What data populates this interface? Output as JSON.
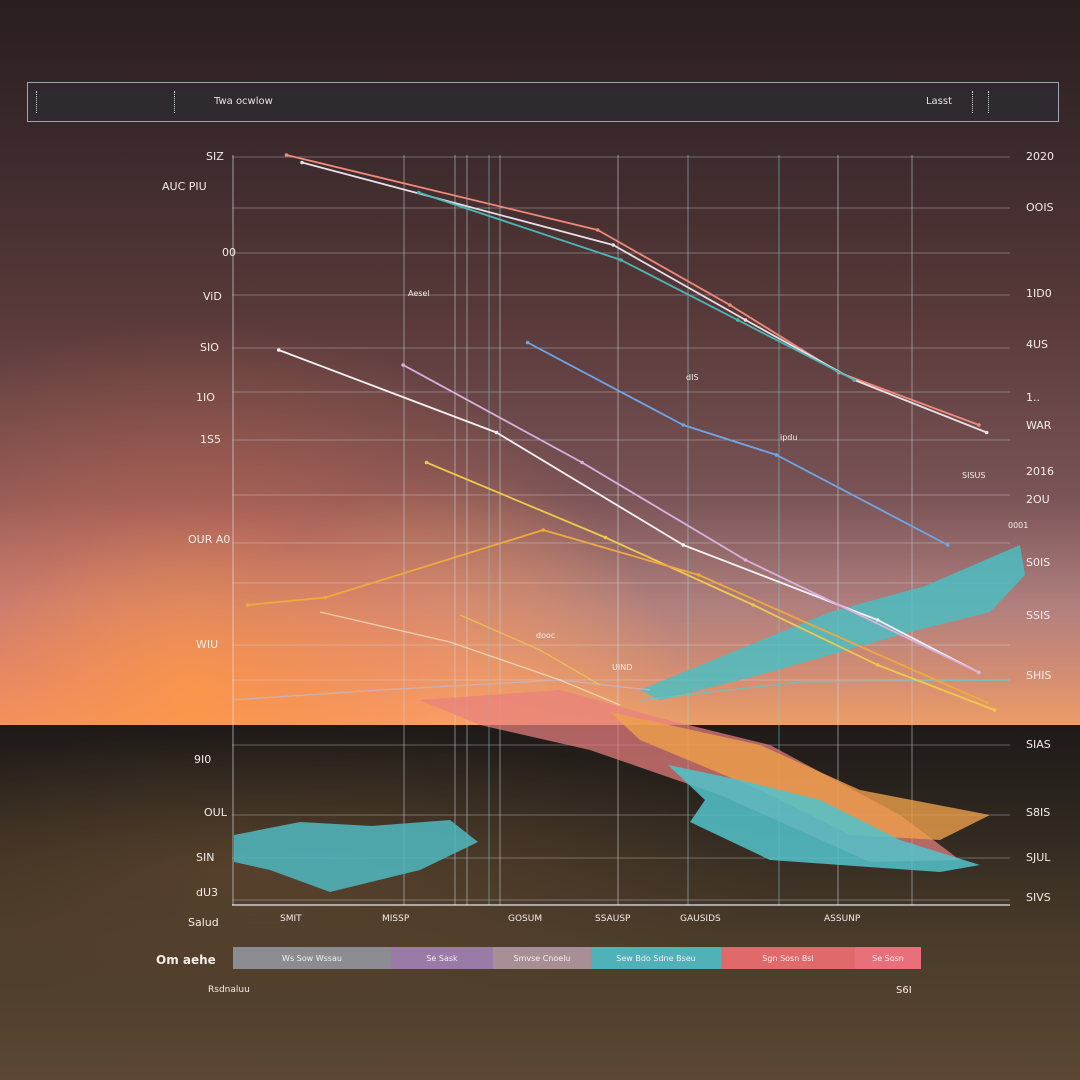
{
  "header": {
    "title": "Twa ocwlow",
    "right_label": "Lasst"
  },
  "chart_data": {
    "type": "line",
    "title": "",
    "xlabel": "",
    "ylabel": "",
    "grid": true,
    "ylim": [
      0,
      100
    ],
    "xlim": [
      0,
      100
    ],
    "left_tick_labels": [
      "SIZ",
      "AUC PIU",
      "00",
      "ViD",
      "SIO",
      "1IO",
      "1S5",
      "OUR A0",
      "WIU",
      "9I0",
      "OUL",
      "SIN",
      "dU3",
      "Salud"
    ],
    "right_tick_labels": [
      "2020",
      "OOIS",
      "1ID0",
      "4US",
      "1..",
      "WAR",
      "2016",
      "2OU",
      "S0IS",
      "SSIS",
      "SHIS",
      "SIAS",
      "S8IS",
      "SJUL",
      "SIVS"
    ],
    "x_tick_labels": [
      "SMIT",
      "MISSP",
      "GOSUM",
      "SSAUSP",
      "GAUSIDS",
      "ASSUNP"
    ],
    "annotations": [
      "Aesel",
      "dooc",
      "UIND",
      "dIS",
      "ipdu",
      "SISUS",
      "0001"
    ],
    "series": [
      {
        "color": "#f08b7a",
        "values": [
          [
            7,
            100
          ],
          [
            47,
            90
          ],
          [
            64,
            80
          ],
          [
            78,
            71
          ],
          [
            96,
            64
          ]
        ]
      },
      {
        "color": "#e8dfe8",
        "values": [
          [
            9,
            99
          ],
          [
            49,
            88
          ],
          [
            66,
            78
          ],
          [
            80,
            70
          ],
          [
            97,
            63
          ]
        ]
      },
      {
        "color": "#4bb7b6",
        "values": [
          [
            24,
            95
          ],
          [
            50,
            86
          ],
          [
            65,
            78
          ],
          [
            80,
            70
          ]
        ]
      },
      {
        "color": "#6fa6e6",
        "values": [
          [
            38,
            75
          ],
          [
            58,
            64
          ],
          [
            70,
            60
          ],
          [
            92,
            48
          ]
        ]
      },
      {
        "color": "#f5f0f4",
        "values": [
          [
            6,
            74
          ],
          [
            34,
            63
          ],
          [
            58,
            48
          ],
          [
            83,
            38
          ],
          [
            96,
            31
          ]
        ]
      },
      {
        "color": "#d8b2e0",
        "values": [
          [
            22,
            72
          ],
          [
            45,
            59
          ],
          [
            66,
            46
          ],
          [
            96,
            31
          ]
        ]
      },
      {
        "color": "#eec94d",
        "values": [
          [
            25,
            59
          ],
          [
            48,
            49
          ],
          [
            67,
            40
          ],
          [
            83,
            32
          ],
          [
            98,
            26
          ]
        ]
      },
      {
        "color": "#f0a840",
        "values": [
          [
            2,
            40
          ],
          [
            12,
            41
          ],
          [
            40,
            50
          ],
          [
            60,
            44
          ],
          [
            97,
            27
          ]
        ]
      }
    ],
    "areas": [
      {
        "color": "#48bfc4",
        "label": "upper wedge"
      },
      {
        "color": "#e87f7e",
        "label": "band"
      },
      {
        "color": "#f0a24a",
        "label": "band"
      },
      {
        "color": "#52c3cb",
        "label": "lower band"
      },
      {
        "color": "#4fb8c0",
        "label": "left blob"
      }
    ],
    "legend_segments": [
      {
        "label": "Ws Sow Wssau",
        "color": "#8b8c92"
      },
      {
        "label": "Se Sask",
        "color": "#9a7aa6"
      },
      {
        "label": "Smvse Cnoelu",
        "color": "#a88f96"
      },
      {
        "label": "Sew Bdo Sdne Bseu",
        "color": "#4fb2b8"
      },
      {
        "label": "Sgn Sosn Bsl",
        "color": "#e06a6a"
      },
      {
        "label": "Se Sosn",
        "color": "#e9707a"
      }
    ],
    "footer_left": "Om aehe",
    "footer_sub": "Rsdnaluu",
    "footer_right": "S6I"
  }
}
